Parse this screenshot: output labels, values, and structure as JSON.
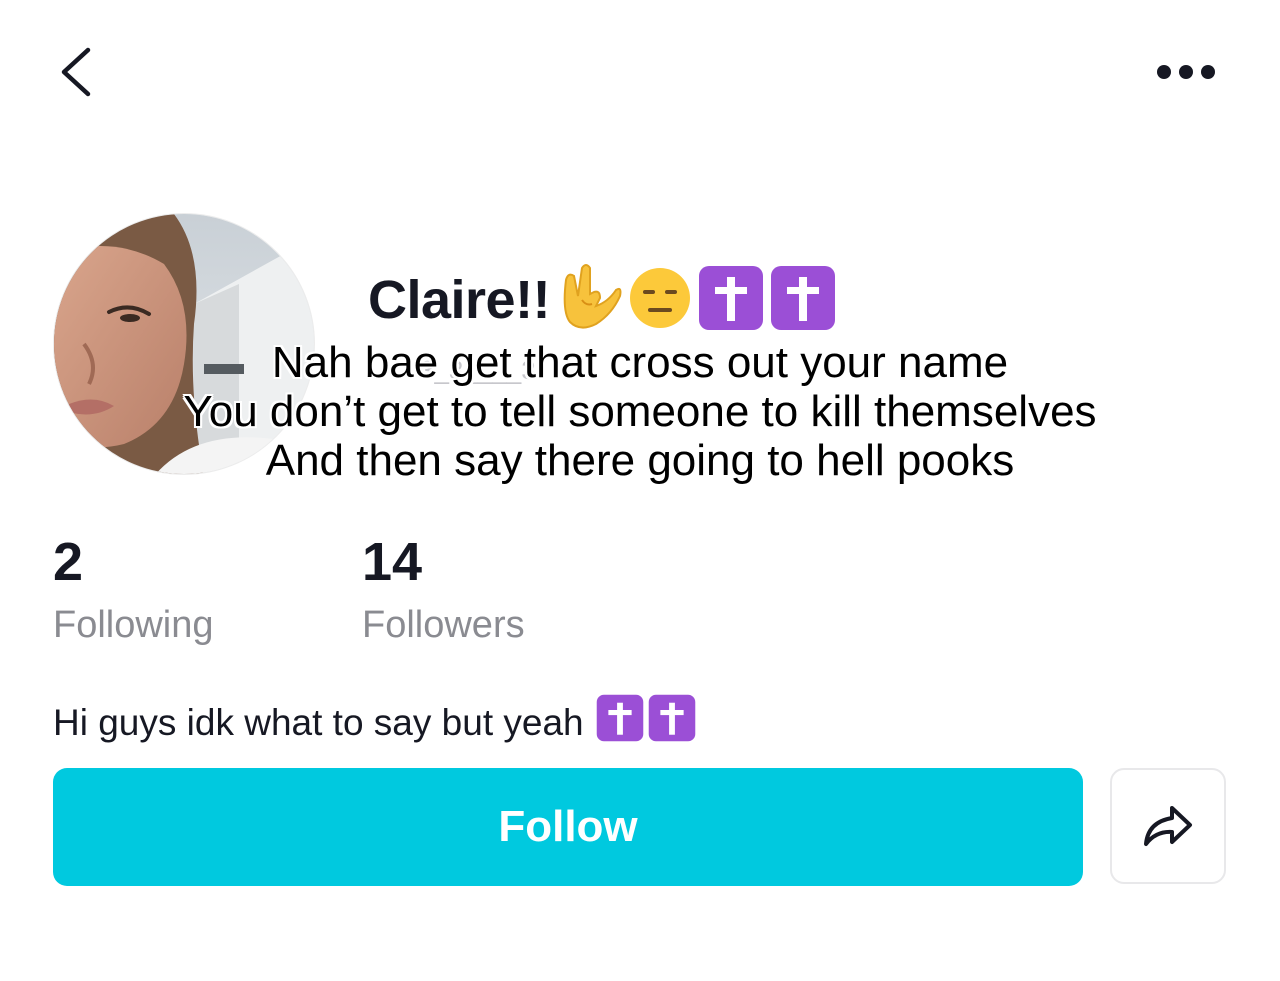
{
  "header": {
    "back_icon": "chevron-left-icon",
    "more_icon": "more-horizontal-icon"
  },
  "profile": {
    "avatar_icon": "profile-photo",
    "display_name": "Claire!!",
    "name_emojis": [
      "love-you-gesture-icon",
      "expressionless-face-icon",
      "latin-cross-icon",
      "latin-cross-icon"
    ],
    "username": "3_3____3"
  },
  "overlay_caption": {
    "line1": "Nah bae get that cross out your name",
    "line2": "You don’t get to tell someone to kill themselves",
    "line3": "And then say there going to hell pooks"
  },
  "stats": {
    "following_count": "2",
    "following_label": "Following",
    "followers_count": "14",
    "followers_label": "Followers"
  },
  "bio": {
    "text": "Hi guys idk what to say but yeah",
    "emojis": [
      "latin-cross-icon",
      "latin-cross-icon"
    ]
  },
  "actions": {
    "follow_label": "Follow",
    "share_icon": "share-arrow-icon"
  },
  "colors": {
    "accent": "#00c9df",
    "cross_purple": "#9b4fd6",
    "text_primary": "#161823",
    "text_secondary": "#8a8b91"
  }
}
